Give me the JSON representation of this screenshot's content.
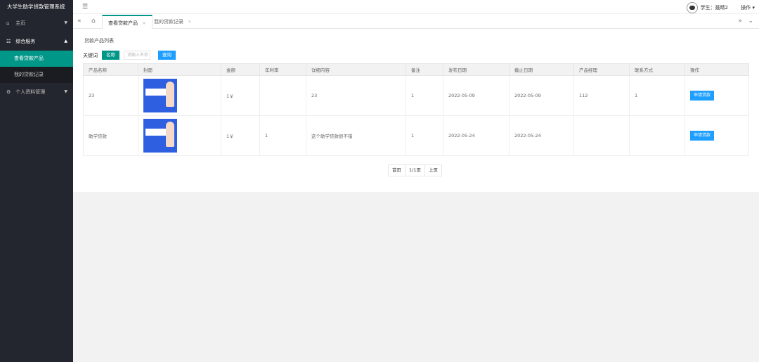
{
  "app": {
    "title": "大学生助学贷款管理系统"
  },
  "sidebar": {
    "items": [
      {
        "label": "主页",
        "icon": "home-icon"
      },
      {
        "label": "综合服务",
        "icon": "list-icon",
        "children": [
          {
            "label": "查看贷款产品"
          },
          {
            "label": "我的贷款记录"
          }
        ]
      },
      {
        "label": "个人资料管理",
        "icon": "gear-icon"
      }
    ]
  },
  "topbar": {
    "user_label": "学生：聂晴2",
    "ops_label": "操作"
  },
  "tabs": [
    {
      "label": "查看贷款产品"
    },
    {
      "label": "我的贷款记录"
    }
  ],
  "page": {
    "breadcrumb": "贷款产品列表"
  },
  "search": {
    "keyword_label": "关键词",
    "type_button": "名称",
    "placeholder": "请输入名称",
    "query_button": "查询"
  },
  "table": {
    "headers": [
      "产品名称",
      "封面",
      "金额",
      "年利率",
      "详细内容",
      "备注",
      "发布日期",
      "截止日期",
      "产品经理",
      "联系方式",
      "操作"
    ],
    "rows": [
      {
        "name": "23",
        "amount": "1￥",
        "rate": "",
        "detail": "23",
        "remark": "1",
        "publish": "2022-05-09",
        "deadline": "2022-05-09",
        "manager": "112",
        "contact": "1",
        "action": "申请贷款"
      },
      {
        "name": "助学贷款",
        "amount": "1￥",
        "rate": "1",
        "detail": "这个助学贷款很不错",
        "remark": "1",
        "publish": "2022-05-24",
        "deadline": "2022-05-24",
        "manager": "",
        "contact": "",
        "action": "申请贷款"
      }
    ]
  },
  "pager": {
    "first": "首页",
    "page": "1/1页",
    "prev": "上页"
  },
  "colors": {
    "sidebar_bg": "#23262e",
    "accent": "#009688",
    "button_blue": "#1e9fff"
  }
}
